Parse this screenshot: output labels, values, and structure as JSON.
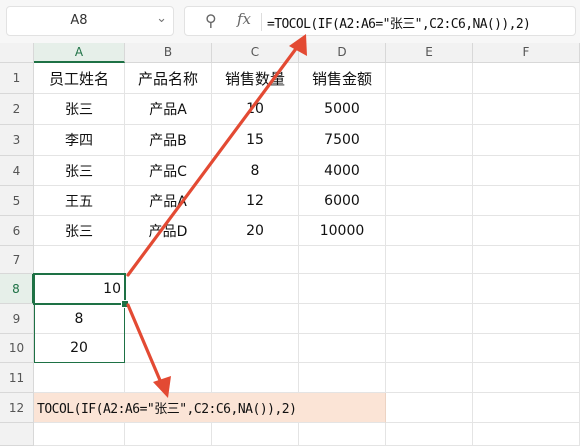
{
  "name_box": {
    "value": "A8"
  },
  "formula_bar": {
    "formula": "=TOCOL(IF(A2:A6=\"张三\",C2:C6,NA()),2)",
    "zoom_icon": "zoom-icon",
    "fx_label": "fx"
  },
  "columns": [
    "A",
    "B",
    "C",
    "D",
    "E",
    "F"
  ],
  "rows": [
    "1",
    "2",
    "3",
    "4",
    "5",
    "6",
    "7",
    "8",
    "9",
    "10",
    "11",
    "12"
  ],
  "headers": {
    "a": "员工姓名",
    "b": "产品名称",
    "c": "销售数量",
    "d": "销售金额"
  },
  "data_rows": [
    {
      "name": "张三",
      "product": "产品A",
      "qty": "10",
      "amount": "5000"
    },
    {
      "name": "李四",
      "product": "产品B",
      "qty": "15",
      "amount": "7500"
    },
    {
      "name": "张三",
      "product": "产品C",
      "qty": "8",
      "amount": "4000"
    },
    {
      "name": "王五",
      "product": "产品A",
      "qty": "12",
      "amount": "6000"
    },
    {
      "name": "张三",
      "product": "产品D",
      "qty": "20",
      "amount": "10000"
    }
  ],
  "result": {
    "a8": "10",
    "a9": "8",
    "a10": "20"
  },
  "formula_text_row12": "TOCOL(IF(A2:A6=\"张三\",C2:C6,NA()),2)",
  "colors": {
    "accent": "#1e7145",
    "annotation_arrow": "#e34a33",
    "highlight_fill": "#fbe4d6"
  }
}
